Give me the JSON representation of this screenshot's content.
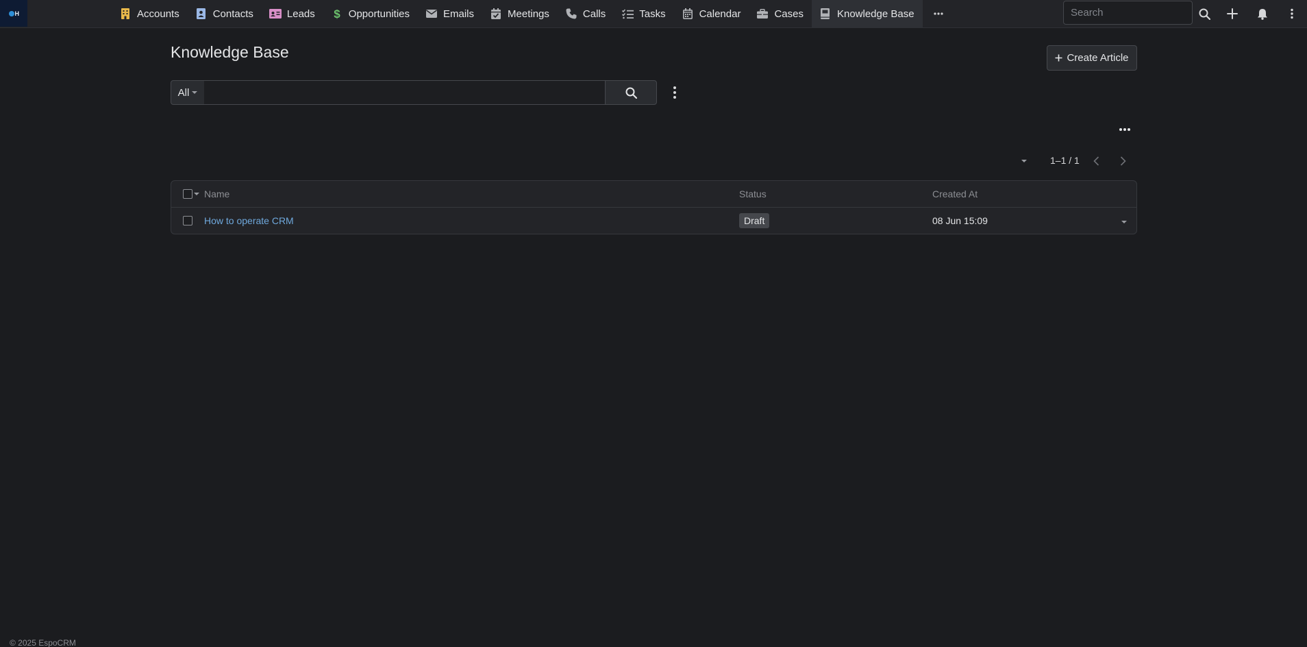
{
  "app": {
    "logo_icon": "company-logo",
    "logo_text": "H"
  },
  "nav": {
    "tabs": [
      {
        "label": "Accounts",
        "icon": "building-icon",
        "color": "#e8b84a"
      },
      {
        "label": "Contacts",
        "icon": "contact-card-icon",
        "color": "#9ab8e6"
      },
      {
        "label": "Leads",
        "icon": "id-card-icon",
        "color": "#d98fc8"
      },
      {
        "label": "Opportunities",
        "icon": "dollar-icon",
        "color": "#6cc26c"
      },
      {
        "label": "Emails",
        "icon": "envelope-icon",
        "color": "#b0b2b6"
      },
      {
        "label": "Meetings",
        "icon": "calendar-check-icon",
        "color": "#b0b2b6"
      },
      {
        "label": "Calls",
        "icon": "phone-icon",
        "color": "#b0b2b6"
      },
      {
        "label": "Tasks",
        "icon": "task-list-icon",
        "color": "#b0b2b6"
      },
      {
        "label": "Calendar",
        "icon": "calendar-icon",
        "color": "#b0b2b6"
      },
      {
        "label": "Cases",
        "icon": "briefcase-icon",
        "color": "#b0b2b6"
      },
      {
        "label": "Knowledge Base",
        "icon": "book-icon",
        "color": "#b0b2b6"
      }
    ],
    "search_placeholder": "Search"
  },
  "page": {
    "title": "Knowledge Base",
    "create_label": "Create Article",
    "filter_label": "All",
    "text_filter_value": "",
    "pagination": "1–1 / 1"
  },
  "table": {
    "columns": [
      "Name",
      "Status",
      "Created At"
    ],
    "rows": [
      {
        "name": "How to operate CRM",
        "status": "Draft",
        "created_at": "08 Jun 15:09"
      }
    ]
  },
  "footer": {
    "text": "© 2025 EspoCRM"
  }
}
